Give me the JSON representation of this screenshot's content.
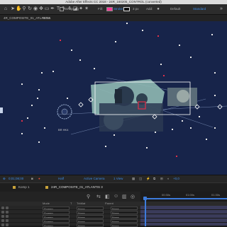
{
  "app": {
    "title": "Adobe After Effects CC 2018 - 24R_160205_CONTROL (converted)"
  },
  "toolbar": {
    "snapping_label": "Snapping",
    "fill_label": "Fill:",
    "stroke_label": "Stroke:",
    "stroke_width": "3 px",
    "add_label": "Add:",
    "workspace_default": "Default",
    "workspace_standard": "Standard",
    "fill_color": "#ff3b9a",
    "accent_color": "#3d8be8",
    "icons": [
      "home-icon",
      "selection-tool-icon",
      "hand-tool-icon",
      "zoom-tool-icon",
      "rotate-tool-icon",
      "camera-tool-icon",
      "pan-behind-icon",
      "rectangle-tool-icon",
      "pen-tool-icon",
      "type-tool-icon",
      "brush-tool-icon",
      "clone-stamp-icon",
      "eraser-icon",
      "roto-brush-icon",
      "puppet-pin-icon"
    ]
  },
  "composition_bar": {
    "current_comp": "4R_COMPOSITE_01_ATLANTIS",
    "next_comp": "TESA"
  },
  "viewer": {
    "background": "#17244a",
    "annotation": "BR HK4"
  },
  "viewer_footer": {
    "timecode": "0;01;08;00",
    "resolution": "Half",
    "camera": "Active Camera",
    "views": "1 View",
    "exposure": "+0,0"
  },
  "timeline_tabs": [
    {
      "label": "Komp 1"
    },
    {
      "label": "24R_COMPOSITE_01_ATLANTIS 3"
    }
  ],
  "ruler": {
    "ticks": [
      "00:30s",
      "01:00s",
      "01:30s"
    ]
  },
  "layer_header": {
    "mode": "Mode",
    "t": "T",
    "trkmat": "TrkMat",
    "parent": "Parent"
  },
  "layers": [
    {
      "mode": "Screen",
      "trkmat": "None",
      "parent": "None"
    },
    {
      "mode": "Screen",
      "trkmat": "None",
      "parent": "None"
    },
    {
      "mode": "Screen",
      "trkmat": "None",
      "parent": "None"
    },
    {
      "mode": "Screen",
      "trkmat": "None",
      "parent": "None"
    },
    {
      "mode": "Screen",
      "trkmat": "None",
      "parent": "None"
    }
  ]
}
